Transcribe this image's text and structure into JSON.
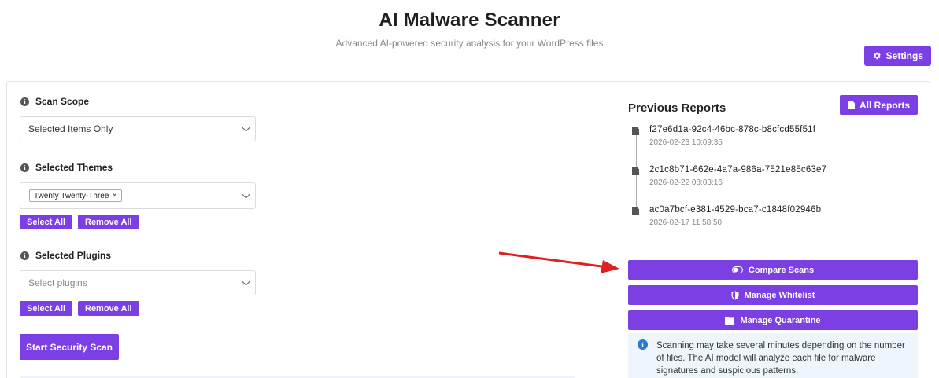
{
  "header": {
    "title": "AI Malware Scanner",
    "subtitle": "Advanced AI-powered security analysis for your WordPress files"
  },
  "settings": {
    "label": "Settings",
    "icon": "gear-icon"
  },
  "scan_scope": {
    "label": "Scan Scope",
    "value": "Selected Items Only"
  },
  "themes": {
    "label": "Selected Themes",
    "chips": [
      "Twenty Twenty-Three"
    ],
    "select_all": "Select All",
    "remove_all": "Remove All"
  },
  "plugins": {
    "label": "Selected Plugins",
    "placeholder": "Select plugins",
    "select_all": "Select All",
    "remove_all": "Remove All"
  },
  "scan_button": "Start Security Scan",
  "reports": {
    "title": "Previous Reports",
    "all_reports": "All Reports",
    "items": [
      {
        "id": "f27e6d1a-92c4-46bc-878c-b8cfcd55f51f",
        "date": "2026-02-23 10:09:35"
      },
      {
        "id": "2c1c8b71-662e-4a7a-986a-7521e85c63e7",
        "date": "2026-02-22 08:03:16"
      },
      {
        "id": "ac0a7bcf-e381-4529-bca7-c1848f02946b",
        "date": "2026-02-17 11:58:50"
      }
    ]
  },
  "actions": {
    "compare": "Compare Scans",
    "whitelist": "Manage Whitelist",
    "quarantine": "Manage Quarantine"
  },
  "notice": "Scanning may take several minutes depending on the number of files. The AI model will analyze each file for malware signatures and suspicious patterns.",
  "colors": {
    "accent": "#7b3fe4",
    "arrow": "#e02020",
    "info": "#2a7ad1"
  }
}
